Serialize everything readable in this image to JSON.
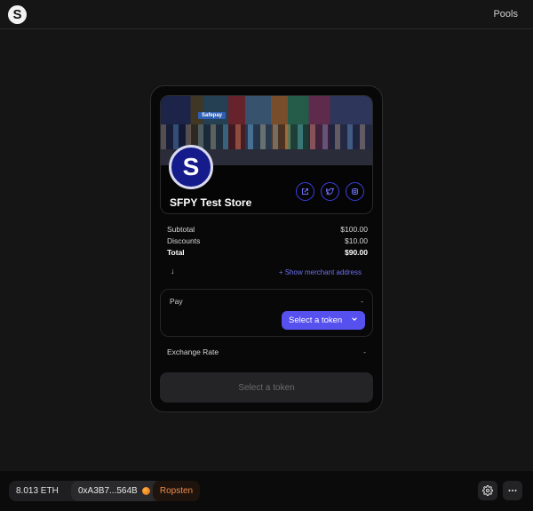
{
  "header": {
    "logo_letter": "S",
    "nav_pools": "Pools"
  },
  "store": {
    "banner_sign": "Safepay",
    "avatar_letter": "S",
    "name": "SFPY Test Store",
    "social_icons": [
      "external-link-icon",
      "twitter-icon",
      "instagram-icon"
    ]
  },
  "summary": {
    "subtotal_label": "Subtotal",
    "subtotal_value": "$100.00",
    "discounts_label": "Discounts",
    "discounts_value": "$10.00",
    "total_label": "Total",
    "total_value": "$90.00"
  },
  "toggle": {
    "arrow": "↓",
    "merchant_link": "+ Show merchant address"
  },
  "pay": {
    "label": "Pay",
    "amount": "-",
    "select_token": "Select a token"
  },
  "exchange": {
    "label": "Exchange Rate",
    "value": "-"
  },
  "submit": {
    "label": "Select a token"
  },
  "footer": {
    "balance": "8.013 ETH",
    "address": "0xA3B7...564B",
    "network": "Ropsten",
    "network_color": "#f0894b",
    "accent_color": "#5650ee"
  }
}
